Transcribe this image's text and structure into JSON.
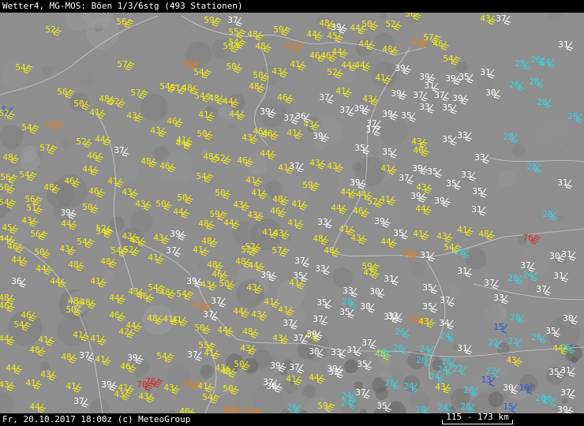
{
  "header": {
    "title": "Wetter4, MG-MOS: Böen 1/3/6stg (493 Stationen)"
  },
  "footer": {
    "datetime_credit": "Fr, 20.10.2017 18:00z (c) MeteoGroup",
    "scale_label": "115 - 173 km"
  },
  "colors": {
    "background": "#8e8e8e",
    "bar": "#000000",
    "light": "#ffffff",
    "cyan": "#33d6e0",
    "yellow": "#f0ec16",
    "orange": "#e87d12",
    "red": "#d92a1e",
    "blue": "#2a56e8"
  },
  "legend_classes": {
    "blue": "gusts up to ~20 km/h",
    "cyan": "gusts 20-29 km/h",
    "white": "gusts 30-39 km/h",
    "yellow": "gusts 40-59 km/h",
    "orange": "gusts 60-69 km/h",
    "red": "gusts 70+ km/h"
  },
  "stations": [
    [
      "59",
      265,
      26
    ],
    [
      "37",
      295,
      26
    ],
    [
      "52",
      495,
      31
    ],
    [
      "50",
      465,
      31
    ],
    [
      "50",
      520,
      18
    ],
    [
      "43",
      615,
      24
    ],
    [
      "37",
      635,
      24
    ],
    [
      "52",
      64,
      38
    ],
    [
      "56",
      154,
      28
    ],
    [
      "55",
      296,
      41
    ],
    [
      "48",
      320,
      44
    ],
    [
      "59",
      353,
      38
    ],
    [
      "39",
      426,
      35
    ],
    [
      "48",
      411,
      30
    ],
    [
      "54",
      296,
      54
    ],
    [
      "59",
      289,
      59
    ],
    [
      "48",
      330,
      59
    ],
    [
      "67",
      369,
      59
    ],
    [
      "44",
      395,
      44
    ],
    [
      "45",
      421,
      46
    ],
    [
      "44",
      450,
      36
    ],
    [
      "65",
      527,
      54
    ],
    [
      "57",
      543,
      48
    ],
    [
      "46",
      555,
      56
    ],
    [
      "31",
      714,
      57
    ],
    [
      "28",
      659,
      81
    ],
    [
      "26",
      679,
      76
    ],
    [
      "24",
      691,
      79
    ],
    [
      "54",
      26,
      86
    ],
    [
      "57",
      155,
      82
    ],
    [
      "65",
      238,
      81
    ],
    [
      "54",
      252,
      92
    ],
    [
      "50",
      293,
      85
    ],
    [
      "41",
      374,
      82
    ],
    [
      "46",
      399,
      71
    ],
    [
      "46",
      413,
      71
    ],
    [
      "44",
      427,
      66
    ],
    [
      "44",
      461,
      56
    ],
    [
      "48",
      491,
      63
    ],
    [
      "54",
      568,
      75
    ],
    [
      "26",
      652,
      108
    ],
    [
      "28",
      677,
      104
    ],
    [
      "31",
      615,
      92
    ],
    [
      "35",
      588,
      98
    ],
    [
      "39",
      507,
      87
    ],
    [
      "41",
      482,
      99
    ],
    [
      "52",
      421,
      92
    ],
    [
      "44",
      439,
      83
    ],
    [
      "44",
      456,
      83
    ],
    [
      "43",
      351,
      91
    ],
    [
      "50",
      327,
      96
    ],
    [
      "39",
      571,
      100
    ],
    [
      "39",
      538,
      98
    ],
    [
      "31",
      544,
      109
    ],
    [
      "30",
      622,
      118
    ],
    [
      "56",
      79,
      117
    ],
    [
      "52",
      145,
      129
    ],
    [
      "57",
      172,
      118
    ],
    [
      "54",
      209,
      110
    ],
    [
      "51",
      222,
      112
    ],
    [
      "48",
      237,
      112
    ],
    [
      "54",
      253,
      122
    ],
    [
      "44",
      289,
      129
    ],
    [
      "48",
      271,
      125
    ],
    [
      "48",
      322,
      110
    ],
    [
      "46",
      358,
      124
    ],
    [
      "37",
      411,
      124
    ],
    [
      "41",
      432,
      116
    ],
    [
      "43",
      466,
      126
    ],
    [
      "39",
      502,
      119
    ],
    [
      "37",
      530,
      121
    ],
    [
      "37",
      557,
      121
    ],
    [
      "39",
      580,
      125
    ],
    [
      "28",
      687,
      130
    ],
    [
      "26",
      726,
      148
    ],
    [
      "5",
      5,
      140
    ],
    [
      "52",
      5,
      144
    ],
    [
      "50",
      100,
      132
    ],
    [
      "48",
      132,
      126
    ],
    [
      "41",
      120,
      143
    ],
    [
      "63",
      65,
      158
    ],
    [
      "54",
      34,
      162
    ],
    [
      "43",
      167,
      147
    ],
    [
      "46",
      218,
      154
    ],
    [
      "41",
      258,
      146
    ],
    [
      "44",
      297,
      145
    ],
    [
      "39",
      336,
      142
    ],
    [
      "37",
      366,
      150
    ],
    [
      "36",
      381,
      148
    ],
    [
      "43",
      391,
      158
    ],
    [
      "37",
      437,
      140
    ],
    [
      "39",
      455,
      138
    ],
    [
      "37",
      471,
      157
    ],
    [
      "39",
      491,
      145
    ],
    [
      "35",
      515,
      147
    ],
    [
      "33",
      538,
      136
    ],
    [
      "35",
      567,
      137
    ],
    [
      "28",
      644,
      174
    ],
    [
      "52",
      103,
      180
    ],
    [
      "57",
      57,
      188
    ],
    [
      "44",
      127,
      177
    ],
    [
      "37",
      151,
      191
    ],
    [
      "43",
      197,
      166
    ],
    [
      "44",
      229,
      182
    ],
    [
      "50",
      256,
      170
    ],
    [
      "41",
      230,
      178
    ],
    [
      "43",
      313,
      175
    ],
    [
      "46",
      327,
      167
    ],
    [
      "48",
      339,
      170
    ],
    [
      "41",
      370,
      169
    ],
    [
      "39",
      403,
      173
    ],
    [
      "35",
      456,
      188
    ],
    [
      "35",
      491,
      193
    ],
    [
      "37",
      470,
      165
    ],
    [
      "43",
      528,
      180
    ],
    [
      "35",
      567,
      177
    ],
    [
      "33",
      586,
      172
    ],
    [
      "40",
      530,
      191
    ],
    [
      "48",
      10,
      200
    ],
    [
      "54",
      31,
      222
    ],
    [
      "46",
      117,
      198
    ],
    [
      "44",
      111,
      215
    ],
    [
      "41",
      143,
      230
    ],
    [
      "48",
      185,
      205
    ],
    [
      "46",
      209,
      211
    ],
    [
      "48",
      264,
      199
    ],
    [
      "52",
      279,
      201
    ],
    [
      "46",
      307,
      204
    ],
    [
      "44",
      336,
      195
    ],
    [
      "41",
      359,
      213
    ],
    [
      "37",
      373,
      211
    ],
    [
      "43",
      399,
      207
    ],
    [
      "43",
      421,
      211
    ],
    [
      "41",
      489,
      214
    ],
    [
      "39",
      529,
      214
    ],
    [
      "35",
      548,
      218
    ],
    [
      "33",
      591,
      222
    ],
    [
      "33",
      608,
      200
    ],
    [
      "28",
      674,
      212
    ],
    [
      "48",
      62,
      238
    ],
    [
      "56",
      7,
      225
    ],
    [
      "50",
      5,
      238
    ],
    [
      "56",
      38,
      253
    ],
    [
      "46",
      88,
      230
    ],
    [
      "46",
      119,
      243
    ],
    [
      "43",
      161,
      244
    ],
    [
      "50",
      231,
      251
    ],
    [
      "54",
      255,
      224
    ],
    [
      "50",
      279,
      245
    ],
    [
      "41",
      318,
      229
    ],
    [
      "41",
      325,
      245
    ],
    [
      "48",
      352,
      253
    ],
    [
      "59",
      390,
      235
    ],
    [
      "44",
      438,
      244
    ],
    [
      "44",
      458,
      247
    ],
    [
      "39",
      450,
      232
    ],
    [
      "37",
      512,
      226
    ],
    [
      "43",
      534,
      238
    ],
    [
      "35",
      572,
      233
    ],
    [
      "35",
      605,
      243
    ],
    [
      "31",
      713,
      232
    ],
    [
      "54",
      5,
      257
    ],
    [
      "51",
      40,
      264
    ],
    [
      "39",
      83,
      270
    ],
    [
      "50",
      111,
      263
    ],
    [
      "43",
      178,
      259
    ],
    [
      "50",
      204,
      259
    ],
    [
      "44",
      226,
      269
    ],
    [
      "59",
      272,
      272
    ],
    [
      "48",
      258,
      284
    ],
    [
      "43",
      302,
      260
    ],
    [
      "43",
      320,
      273
    ],
    [
      "46",
      349,
      268
    ],
    [
      "41",
      376,
      259
    ],
    [
      "44",
      426,
      264
    ],
    [
      "46",
      454,
      268
    ],
    [
      "52",
      472,
      256
    ],
    [
      "41",
      488,
      253
    ],
    [
      "44",
      533,
      265
    ],
    [
      "39",
      527,
      249
    ],
    [
      "39",
      557,
      255
    ],
    [
      "31",
      604,
      266
    ],
    [
      "28",
      694,
      272
    ],
    [
      "44",
      84,
      284
    ],
    [
      "43",
      34,
      280
    ],
    [
      "45",
      9,
      289
    ],
    [
      "56",
      45,
      297
    ],
    [
      "54",
      104,
      307
    ],
    [
      "54",
      128,
      294
    ],
    [
      "52",
      128,
      290
    ],
    [
      "43",
      161,
      300
    ],
    [
      "39",
      222,
      297
    ],
    [
      "48",
      262,
      306
    ],
    [
      "44",
      290,
      283
    ],
    [
      "41",
      371,
      283
    ],
    [
      "33",
      409,
      282
    ],
    [
      "39",
      481,
      281
    ],
    [
      "41",
      436,
      291
    ],
    [
      "35",
      505,
      296
    ],
    [
      "41",
      530,
      297
    ],
    [
      "43",
      560,
      300
    ],
    [
      "41",
      586,
      292
    ],
    [
      "48",
      613,
      297
    ],
    [
      "76",
      669,
      302
    ],
    [
      "31",
      718,
      323
    ],
    [
      "30",
      703,
      325
    ],
    [
      "44",
      5,
      303
    ],
    [
      "46",
      16,
      313
    ],
    [
      "50",
      50,
      320
    ],
    [
      "43",
      82,
      316
    ],
    [
      "54",
      147,
      318
    ],
    [
      "52",
      163,
      317
    ],
    [
      "43",
      171,
      305
    ],
    [
      "43",
      201,
      302
    ],
    [
      "37",
      217,
      318
    ],
    [
      "41",
      251,
      317
    ],
    [
      "52",
      317,
      313
    ],
    [
      "52",
      312,
      317
    ],
    [
      "57",
      351,
      318
    ],
    [
      "41",
      339,
      295
    ],
    [
      "43",
      353,
      296
    ],
    [
      "48",
      403,
      303
    ],
    [
      "46",
      417,
      318
    ],
    [
      "43",
      451,
      302
    ],
    [
      "44",
      489,
      307
    ],
    [
      "69",
      516,
      322
    ],
    [
      "31",
      539,
      324
    ],
    [
      "54",
      569,
      314
    ],
    [
      "28",
      583,
      320
    ],
    [
      "37",
      666,
      337
    ],
    [
      "44",
      21,
      330
    ],
    [
      "44",
      52,
      341
    ],
    [
      "48",
      93,
      336
    ],
    [
      "48",
      134,
      332
    ],
    [
      "41",
      194,
      327
    ],
    [
      "48",
      269,
      336
    ],
    [
      "46",
      275,
      348
    ],
    [
      "48",
      305,
      332
    ],
    [
      "44",
      321,
      337
    ],
    [
      "37",
      380,
      331
    ],
    [
      "35",
      378,
      350
    ],
    [
      "33",
      406,
      341
    ],
    [
      "59",
      465,
      338
    ],
    [
      "42",
      467,
      346
    ],
    [
      "31",
      493,
      354
    ],
    [
      "31",
      586,
      344
    ],
    [
      "28",
      650,
      353
    ],
    [
      "24",
      669,
      349
    ],
    [
      "31",
      708,
      350
    ],
    [
      "36",
      21,
      357
    ],
    [
      "44",
      70,
      357
    ],
    [
      "41",
      121,
      357
    ],
    [
      "43",
      169,
      370
    ],
    [
      "54",
      194,
      365
    ],
    [
      "48",
      209,
      371
    ],
    [
      "39",
      243,
      357
    ],
    [
      "37",
      274,
      382
    ],
    [
      "50",
      284,
      360
    ],
    [
      "39",
      337,
      349
    ],
    [
      "41",
      373,
      359
    ],
    [
      "35",
      408,
      384
    ],
    [
      "33",
      441,
      369
    ],
    [
      "30",
      475,
      370
    ],
    [
      "35",
      542,
      365
    ],
    [
      "37",
      564,
      381
    ],
    [
      "37",
      620,
      359
    ],
    [
      "33",
      632,
      378
    ],
    [
      "37",
      686,
      367
    ],
    [
      "48",
      5,
      378
    ],
    [
      "46",
      5,
      388
    ],
    [
      "48",
      93,
      382
    ],
    [
      "44",
      145,
      378
    ],
    [
      "46",
      181,
      376
    ],
    [
      "54",
      230,
      373
    ],
    [
      "43",
      261,
      361
    ],
    [
      "43",
      319,
      365
    ],
    [
      "41",
      341,
      383
    ],
    [
      "41",
      359,
      393
    ],
    [
      "28",
      440,
      383
    ],
    [
      "35",
      437,
      396
    ],
    [
      "30",
      463,
      389
    ],
    [
      "35",
      542,
      389
    ],
    [
      "33",
      498,
      401
    ],
    [
      "61",
      526,
      405
    ],
    [
      "43",
      537,
      408
    ],
    [
      "54",
      24,
      412
    ],
    [
      "46",
      33,
      400
    ],
    [
      "50",
      90,
      393
    ],
    [
      "48",
      108,
      384
    ],
    [
      "46",
      145,
      400
    ],
    [
      "44",
      166,
      413
    ],
    [
      "48",
      193,
      404
    ],
    [
      "41",
      213,
      405
    ],
    [
      "67",
      252,
      388
    ],
    [
      "37",
      264,
      399
    ],
    [
      "44",
      302,
      395
    ],
    [
      "43",
      325,
      399
    ],
    [
      "37",
      365,
      410
    ],
    [
      "43",
      393,
      426
    ],
    [
      "39",
      395,
      424
    ],
    [
      "37",
      403,
      405
    ],
    [
      "26",
      507,
      421
    ],
    [
      "33",
      493,
      402
    ],
    [
      "37",
      465,
      435
    ],
    [
      "28",
      653,
      403
    ],
    [
      "30",
      720,
      404
    ],
    [
      "35",
      698,
      420
    ],
    [
      "15",
      632,
      415
    ],
    [
      "34",
      563,
      410
    ],
    [
      "44",
      5,
      430
    ],
    [
      "41",
      55,
      431
    ],
    [
      "41",
      99,
      425
    ],
    [
      "41",
      121,
      430
    ],
    [
      "42",
      157,
      421
    ],
    [
      "41",
      224,
      406
    ],
    [
      "50",
      253,
      416
    ],
    [
      "44",
      282,
      419
    ],
    [
      "48",
      314,
      421
    ],
    [
      "43",
      352,
      429
    ],
    [
      "37",
      378,
      429
    ],
    [
      "31",
      446,
      444
    ],
    [
      "48",
      482,
      449
    ],
    [
      "24",
      564,
      426
    ],
    [
      "22",
      625,
      435
    ],
    [
      "22",
      650,
      433
    ],
    [
      "26",
      680,
      428
    ],
    [
      "48",
      44,
      444
    ],
    [
      "41",
      127,
      456
    ],
    [
      "39",
      168,
      454
    ],
    [
      "54",
      205,
      452
    ],
    [
      "55",
      258,
      438
    ],
    [
      "41",
      265,
      448
    ],
    [
      "48",
      286,
      471
    ],
    [
      "43",
      311,
      442
    ],
    [
      "30",
      398,
      446
    ],
    [
      "33",
      426,
      447
    ],
    [
      "39",
      421,
      468
    ],
    [
      "35",
      459,
      462
    ],
    [
      "24",
      538,
      443
    ],
    [
      "31",
      586,
      442
    ],
    [
      "44",
      707,
      442
    ],
    [
      "26",
      717,
      441
    ],
    [
      "44",
      14,
      467
    ],
    [
      "43",
      58,
      475
    ],
    [
      "48",
      84,
      453
    ],
    [
      "37",
      107,
      451
    ],
    [
      "46",
      159,
      465
    ],
    [
      "37",
      244,
      450
    ],
    [
      "43",
      279,
      467
    ],
    [
      "50",
      303,
      462
    ],
    [
      "39",
      349,
      464
    ],
    [
      "37",
      373,
      466
    ],
    [
      "44",
      398,
      479
    ],
    [
      "33",
      423,
      472
    ],
    [
      "20",
      505,
      442
    ],
    [
      "28",
      484,
      447
    ],
    [
      "20",
      534,
      457
    ],
    [
      "24",
      561,
      469
    ],
    [
      "22",
      580,
      468
    ],
    [
      "43",
      648,
      457
    ],
    [
      "24",
      551,
      478
    ],
    [
      "22",
      622,
      471
    ],
    [
      "13",
      616,
      482
    ],
    [
      "35",
      702,
      472
    ],
    [
      "31",
      717,
      470
    ],
    [
      "26",
      566,
      459
    ],
    [
      "43",
      5,
      488
    ],
    [
      "41",
      39,
      486
    ],
    [
      "41",
      90,
      490
    ],
    [
      "39",
      135,
      488
    ],
    [
      "41",
      156,
      492
    ],
    [
      "70",
      180,
      488
    ],
    [
      "76",
      191,
      484
    ],
    [
      "61",
      239,
      487
    ],
    [
      "41",
      257,
      490
    ],
    [
      "43",
      214,
      492
    ],
    [
      "50",
      289,
      493
    ],
    [
      "39",
      344,
      490
    ],
    [
      "37",
      340,
      485
    ],
    [
      "41",
      369,
      481
    ],
    [
      "24",
      439,
      502
    ],
    [
      "37",
      457,
      498
    ],
    [
      "26",
      494,
      486
    ],
    [
      "24",
      518,
      490
    ],
    [
      "43",
      558,
      491
    ],
    [
      "28",
      594,
      495
    ],
    [
      "30",
      644,
      492
    ],
    [
      "10",
      664,
      492
    ],
    [
      "37",
      717,
      498
    ],
    [
      "20",
      685,
      505
    ],
    [
      "20",
      694,
      507
    ],
    [
      "44",
      44,
      516
    ],
    [
      "37",
      100,
      509
    ],
    [
      "43",
      182,
      503
    ],
    [
      "54",
      263,
      504
    ],
    [
      "40",
      234,
      522
    ],
    [
      "65",
      316,
      522
    ],
    [
      "26",
      370,
      517
    ],
    [
      "59",
      409,
      515
    ],
    [
      "24",
      439,
      511
    ],
    [
      "35",
      484,
      515
    ],
    [
      "28",
      533,
      520
    ],
    [
      "24",
      561,
      517
    ],
    [
      "28",
      590,
      516
    ],
    [
      "15",
      644,
      516
    ],
    [
      "39",
      713,
      520
    ],
    [
      "43",
      151,
      500
    ],
    [
      "60",
      290,
      520
    ]
  ]
}
